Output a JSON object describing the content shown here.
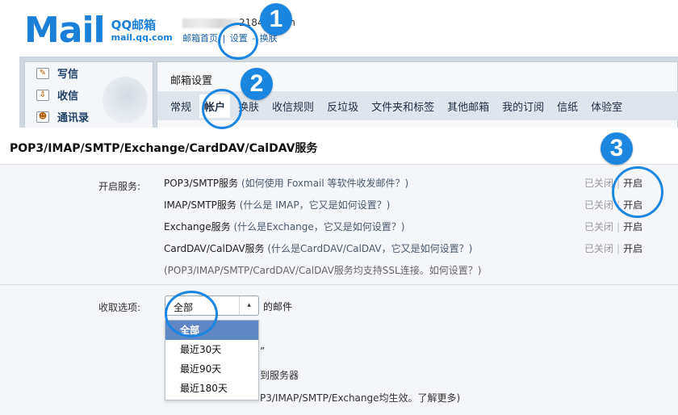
{
  "logo": {
    "word": "Mail",
    "brand": "QQ邮箱",
    "domain": "mail.qq.com"
  },
  "account": {
    "partial_id": "21840",
    "suffix": "n"
  },
  "top_links": {
    "home": "邮箱首页",
    "sep1": " | ",
    "settings": "设置",
    "sep2": " - ",
    "switch": "换肤"
  },
  "sidebar": {
    "items": [
      {
        "label": "写信",
        "icon": "pencil-icon"
      },
      {
        "label": "收信",
        "icon": "inbox-icon"
      },
      {
        "label": "通讯录",
        "icon": "contacts-icon"
      }
    ]
  },
  "settings": {
    "title": "邮箱设置",
    "tabs": [
      "常规",
      "帐户",
      "换肤",
      "收信规则",
      "反垃圾",
      "文件夹和标签",
      "其他邮箱",
      "我的订阅",
      "信纸",
      "体验室"
    ],
    "active_tab": "帐户"
  },
  "panel": {
    "title": "POP3/IMAP/SMTP/Exchange/CardDAV/CalDAV服务",
    "enable_label": "开启服务:",
    "services": [
      {
        "name": "POP3/SMTP服务",
        "hint": "(如何使用 Foxmail 等软件收发邮件？)",
        "status": "已关闭",
        "action": "开启"
      },
      {
        "name": "IMAP/SMTP服务",
        "hint": "(什么是 IMAP，它又是如何设置？)",
        "status": "已关闭",
        "action": "开启"
      },
      {
        "name": "Exchange服务",
        "hint": "(什么是Exchange，它又是如何设置？)",
        "status": "已关闭",
        "action": "开启"
      },
      {
        "name": "CardDAV/CalDAV服务",
        "hint": "(什么是CardDAV/CalDAV，它又是如何设置？)",
        "status": "已关闭",
        "action": "开启"
      }
    ],
    "ssl_note": "(POP3/IMAP/SMTP/CardDAV/CalDAV服务均支持SSL连接。如何设置？)",
    "receive_label": "收取选项:",
    "select_value": "全部",
    "after_select": "的邮件",
    "dropdown_options": [
      "全部",
      "最近30天",
      "最近90天",
      "最近180天"
    ],
    "behind_quote": "”",
    "behind_server": "到服务器",
    "behind_note": "P3/IMAP/SMTP/Exchange均生效。了解更多)"
  },
  "annotations": [
    "1",
    "2",
    "3"
  ],
  "colors": {
    "accent": "#1a86e0",
    "brand": "#1a7fd6",
    "dropdown_selected": "#5f87c4"
  }
}
